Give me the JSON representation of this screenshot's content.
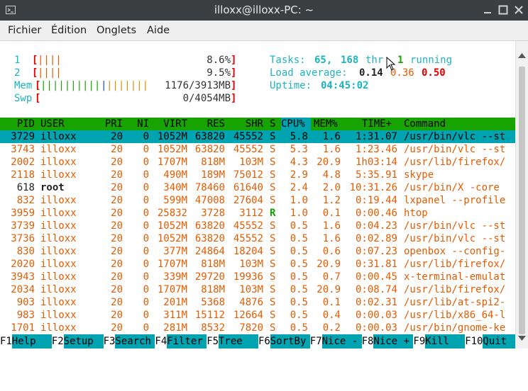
{
  "window": {
    "title": "illoxx@illoxx-PC: ~"
  },
  "menu": {
    "items": [
      "Fichier",
      "Édition",
      "Onglets",
      "Aide"
    ]
  },
  "meters": {
    "cpu1": {
      "label": "1",
      "bar": "||||",
      "value": "8.6%"
    },
    "cpu2": {
      "label": "2",
      "bar": "||||",
      "value": "9.5%"
    },
    "mem": {
      "label": "Mem",
      "bar_green": "||||||||||",
      "bar_blue": "|",
      "bar_orange": "|||||||",
      "value": "1176/3913MB"
    },
    "swp": {
      "label": "Swp",
      "value": "0/4054MB"
    }
  },
  "summary": {
    "tasks_label": "Tasks:",
    "tasks": "65,",
    "thr": "168",
    "thr_label": "thr",
    "running": "1",
    "running_label": "running",
    "load_label": "Load average:",
    "load1": "0.14",
    "load5": "0.36",
    "load15": "0.50",
    "uptime_label": "Uptime:",
    "uptime": "04:45:02"
  },
  "colors": {
    "header": "#17a300",
    "selected": "#00a3b0",
    "orange": "#e55b00",
    "cyan": "#1ab5c1",
    "green": "#16a400",
    "red": "#e00000"
  },
  "table": {
    "columns": [
      "PID",
      "USER",
      "PRI",
      "NI",
      "VIRT",
      "RES",
      "SHR",
      "S",
      "CPU%",
      "MEM%",
      "TIME+",
      "Command"
    ],
    "rows": [
      {
        "pid": "3729",
        "user": "illoxx",
        "pri": "20",
        "ni": "0",
        "virt": "1052M",
        "res": "63820",
        "shr": "45552",
        "s": "S",
        "cpu": "5.8",
        "mem": "1.6",
        "time": "1:31.07",
        "cmd": "/usr/bin/vlc --st"
      },
      {
        "pid": "3743",
        "user": "illoxx",
        "pri": "20",
        "ni": "0",
        "virt": "1052M",
        "res": "63820",
        "shr": "45552",
        "s": "S",
        "cpu": "5.3",
        "mem": "1.6",
        "time": "1:23.46",
        "cmd": "/usr/bin/vlc --st"
      },
      {
        "pid": "2002",
        "user": "illoxx",
        "pri": "20",
        "ni": "0",
        "virt": "1707M",
        "res": "818M",
        "shr": "103M",
        "s": "S",
        "cpu": "4.3",
        "mem": "20.9",
        "time": "1h03:14",
        "cmd": "/usr/lib/firefox/"
      },
      {
        "pid": "2118",
        "user": "illoxx",
        "pri": "20",
        "ni": "0",
        "virt": "490M",
        "res": "189M",
        "shr": "75012",
        "s": "S",
        "cpu": "2.9",
        "mem": "4.8",
        "time": "5:35.91",
        "cmd": "skype"
      },
      {
        "pid": "618",
        "user": "root",
        "pri": "20",
        "ni": "0",
        "virt": "340M",
        "res": "78460",
        "shr": "61640",
        "s": "S",
        "cpu": "2.4",
        "mem": "2.0",
        "time": "10:31.26",
        "cmd": "/usr/bin/X -core"
      },
      {
        "pid": "832",
        "user": "illoxx",
        "pri": "20",
        "ni": "0",
        "virt": "599M",
        "res": "47008",
        "shr": "27604",
        "s": "S",
        "cpu": "1.0",
        "mem": "1.2",
        "time": "0:19.44",
        "cmd": "lxpanel --profile"
      },
      {
        "pid": "3959",
        "user": "illoxx",
        "pri": "20",
        "ni": "0",
        "virt": "25832",
        "res": "3728",
        "shr": "3112",
        "s": "R",
        "cpu": "1.0",
        "mem": "0.1",
        "time": "0:00.46",
        "cmd": "htop"
      },
      {
        "pid": "3739",
        "user": "illoxx",
        "pri": "20",
        "ni": "0",
        "virt": "1052M",
        "res": "63820",
        "shr": "45552",
        "s": "S",
        "cpu": "0.5",
        "mem": "1.6",
        "time": "0:04.23",
        "cmd": "/usr/bin/vlc --st"
      },
      {
        "pid": "3736",
        "user": "illoxx",
        "pri": "20",
        "ni": "0",
        "virt": "1052M",
        "res": "63820",
        "shr": "45552",
        "s": "S",
        "cpu": "0.5",
        "mem": "1.6",
        "time": "0:02.89",
        "cmd": "/usr/bin/vlc --st"
      },
      {
        "pid": "830",
        "user": "illoxx",
        "pri": "20",
        "ni": "0",
        "virt": "377M",
        "res": "24864",
        "shr": "18204",
        "s": "S",
        "cpu": "0.5",
        "mem": "0.6",
        "time": "0:07.23",
        "cmd": "openbox --config-"
      },
      {
        "pid": "2020",
        "user": "illoxx",
        "pri": "20",
        "ni": "0",
        "virt": "1707M",
        "res": "818M",
        "shr": "103M",
        "s": "S",
        "cpu": "0.5",
        "mem": "20.9",
        "time": "0:31.81",
        "cmd": "/usr/lib/firefox/"
      },
      {
        "pid": "3943",
        "user": "illoxx",
        "pri": "20",
        "ni": "0",
        "virt": "339M",
        "res": "29720",
        "shr": "19936",
        "s": "S",
        "cpu": "0.5",
        "mem": "0.7",
        "time": "0:00.45",
        "cmd": "x-terminal-emulat"
      },
      {
        "pid": "2034",
        "user": "illoxx",
        "pri": "20",
        "ni": "0",
        "virt": "1707M",
        "res": "818M",
        "shr": "103M",
        "s": "S",
        "cpu": "0.5",
        "mem": "20.9",
        "time": "0:08.74",
        "cmd": "/usr/lib/firefox/"
      },
      {
        "pid": "903",
        "user": "illoxx",
        "pri": "20",
        "ni": "0",
        "virt": "201M",
        "res": "5368",
        "shr": "4876",
        "s": "S",
        "cpu": "0.5",
        "mem": "0.1",
        "time": "0:02.31",
        "cmd": "/usr/lib/at-spi2-"
      },
      {
        "pid": "983",
        "user": "illoxx",
        "pri": "20",
        "ni": "0",
        "virt": "311M",
        "res": "15112",
        "shr": "12664",
        "s": "S",
        "cpu": "0.5",
        "mem": "0.4",
        "time": "0:00.03",
        "cmd": "/usr/lib/x86_64-l"
      },
      {
        "pid": "1701",
        "user": "illoxx",
        "pri": "20",
        "ni": "0",
        "virt": "281M",
        "res": "8532",
        "shr": "7820",
        "s": "S",
        "cpu": "0.5",
        "mem": "0.2",
        "time": "0:00.03",
        "cmd": "/usr/bin/gnome-ke"
      }
    ]
  },
  "fkeys": [
    {
      "key": "F1",
      "label": "Help"
    },
    {
      "key": "F2",
      "label": "Setup"
    },
    {
      "key": "F3",
      "label": "Search"
    },
    {
      "key": "F4",
      "label": "Filter"
    },
    {
      "key": "F5",
      "label": "Tree"
    },
    {
      "key": "F6",
      "label": "SortBy"
    },
    {
      "key": "F7",
      "label": "Nice -"
    },
    {
      "key": "F8",
      "label": "Nice +"
    },
    {
      "key": "F9",
      "label": "Kill"
    },
    {
      "key": "F10",
      "label": "Quit"
    }
  ]
}
